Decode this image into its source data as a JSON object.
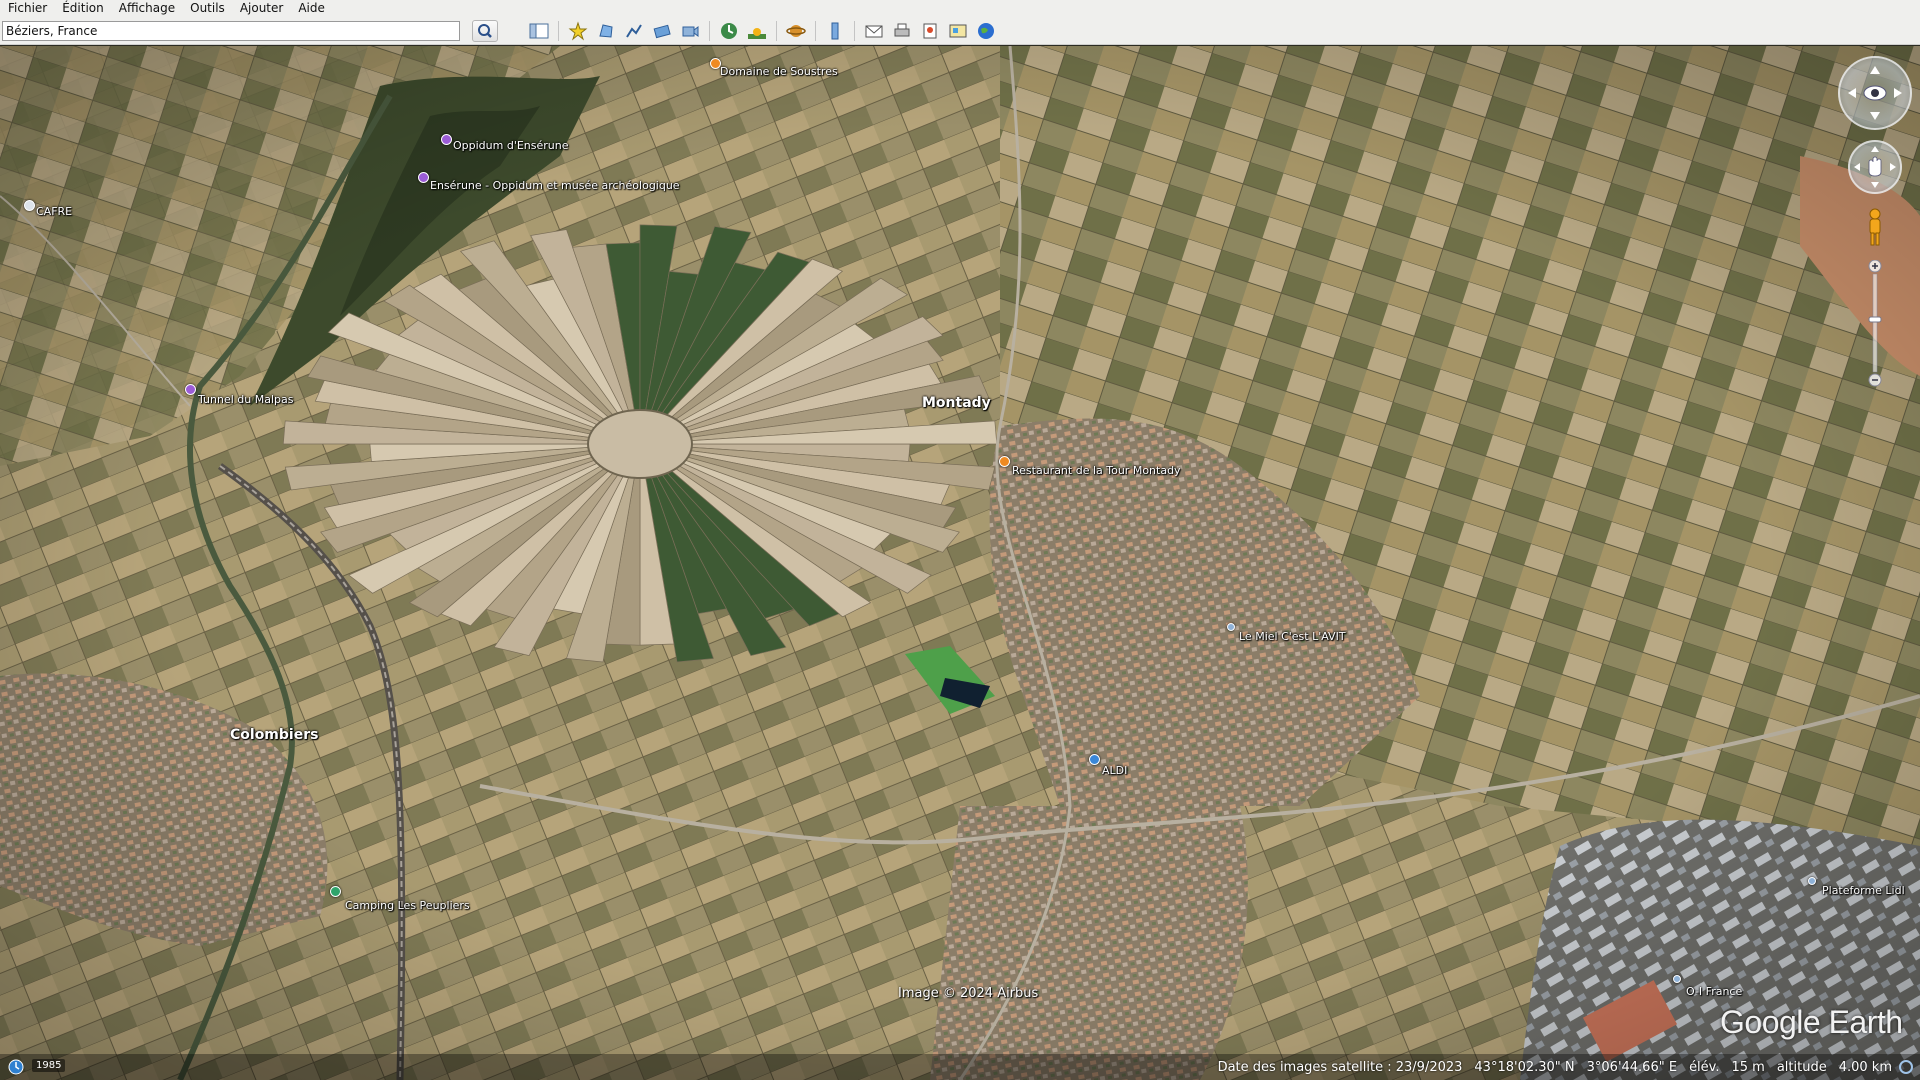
{
  "menu": [
    "Fichier",
    "Édition",
    "Affichage",
    "Outils",
    "Ajouter",
    "Aide"
  ],
  "search": {
    "value": "Béziers, France"
  },
  "toolbar_icons": [
    "sidebar-toggle-icon",
    "add-placemark-icon",
    "add-polygon-icon",
    "add-path-icon",
    "add-image-overlay-icon",
    "record-tour-icon",
    "historical-imagery-icon",
    "sunlight-icon",
    "switch-to-planets-icon",
    "ruler-icon",
    "email-icon",
    "print-icon",
    "save-image-icon",
    "view-in-maps-icon",
    "earth-icon"
  ],
  "places": {
    "domaine_soustres": "Domaine de Soustres",
    "oppidum": "Oppidum d'Ensérune",
    "enserune": "Ensérune - Oppidum et musée archéologique",
    "cafre": "CAFRE",
    "tunnel": "Tunnel du Malpas",
    "montady": "Montady",
    "restaurant": "Restaurant de la Tour Montady",
    "miel": "Le Miel C'est L'AVIT",
    "aldi": "ALDI",
    "colombiers": "Colombiers",
    "camping": "Camping Les Peupliers",
    "plateforme": "Plateforme Lidl",
    "oi_france": "O-I France"
  },
  "copyright": "Image © 2024 Airbus",
  "logo": "Google Earth",
  "status": {
    "year": "1985",
    "imagery_date": "Date des images satellite : 23/9/2023",
    "lat": "43°18'02.30\" N",
    "lon": "3°06'44.66\" E",
    "elev_label": "élév.",
    "elev_value": "15 m",
    "alt_label": "altitude",
    "alt_value": "4.00 km"
  }
}
